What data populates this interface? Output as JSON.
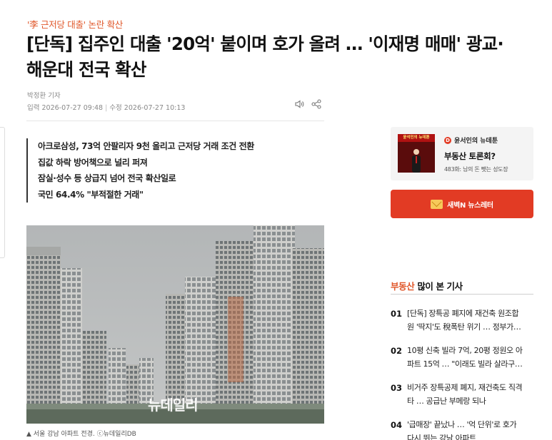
{
  "category": {
    "highlight": "'李 근저당 대출'",
    "rest": " 논란 확산"
  },
  "headline": {
    "line1": "[단독] 집주인 대출 '20억' 붙이며 호가 올려 … '이재명 매매' 광교·",
    "line2": "해운대 전국 확산"
  },
  "byline": "박정환 기자",
  "dates": {
    "input": "입력 2026-07-27 09:48",
    "modified": "수정 2026-07-27 10:13"
  },
  "subheads": [
    "아크로삼성, 73억 안팔리자 9천 올리고 근저당 거래 조건 전환",
    "집값 하락 방어책으로 널리 퍼져",
    "잠실·성수 등 상급지 넘어 전국 확산일로",
    "국민 64.4% \"부적절한 거래\""
  ],
  "photo": {
    "watermark": "뉴데일리",
    "caption": "▲ 서울 강남 아파트 전경. ⓒ뉴데일리DB"
  },
  "promo": {
    "banner_text": "윤석민의 뉴데툰",
    "source": "윤서인의 뉴데툰",
    "title": "부동산 토론회?",
    "meta": "483화: 남의 돈 뺏는 성도장"
  },
  "newsletter": {
    "label": "새벽N 뉴스레터"
  },
  "popular": {
    "category": "부동산",
    "title": "많이 본 기사",
    "items": [
      {
        "num": "01",
        "line1": "[단독] 장특공 폐지에 재건축 원조합",
        "line2": "원 '딱지'도 稅폭탄 위기 … 정부가…"
      },
      {
        "num": "02",
        "line1": "10평 신축 빌라 7억, 20평 정원오 아",
        "line2": "파트 15억 … \"이래도 빌라 살라구…"
      },
      {
        "num": "03",
        "line1": "비거주 장특공제 폐지, 재건축도 직격",
        "line2": "타 … 공급난 부메랑 되나"
      },
      {
        "num": "04",
        "line1": "'급매장' 끝났나 … '억 단위'로 호가",
        "line2": "다시 뛰는 강남 아파트"
      }
    ]
  }
}
